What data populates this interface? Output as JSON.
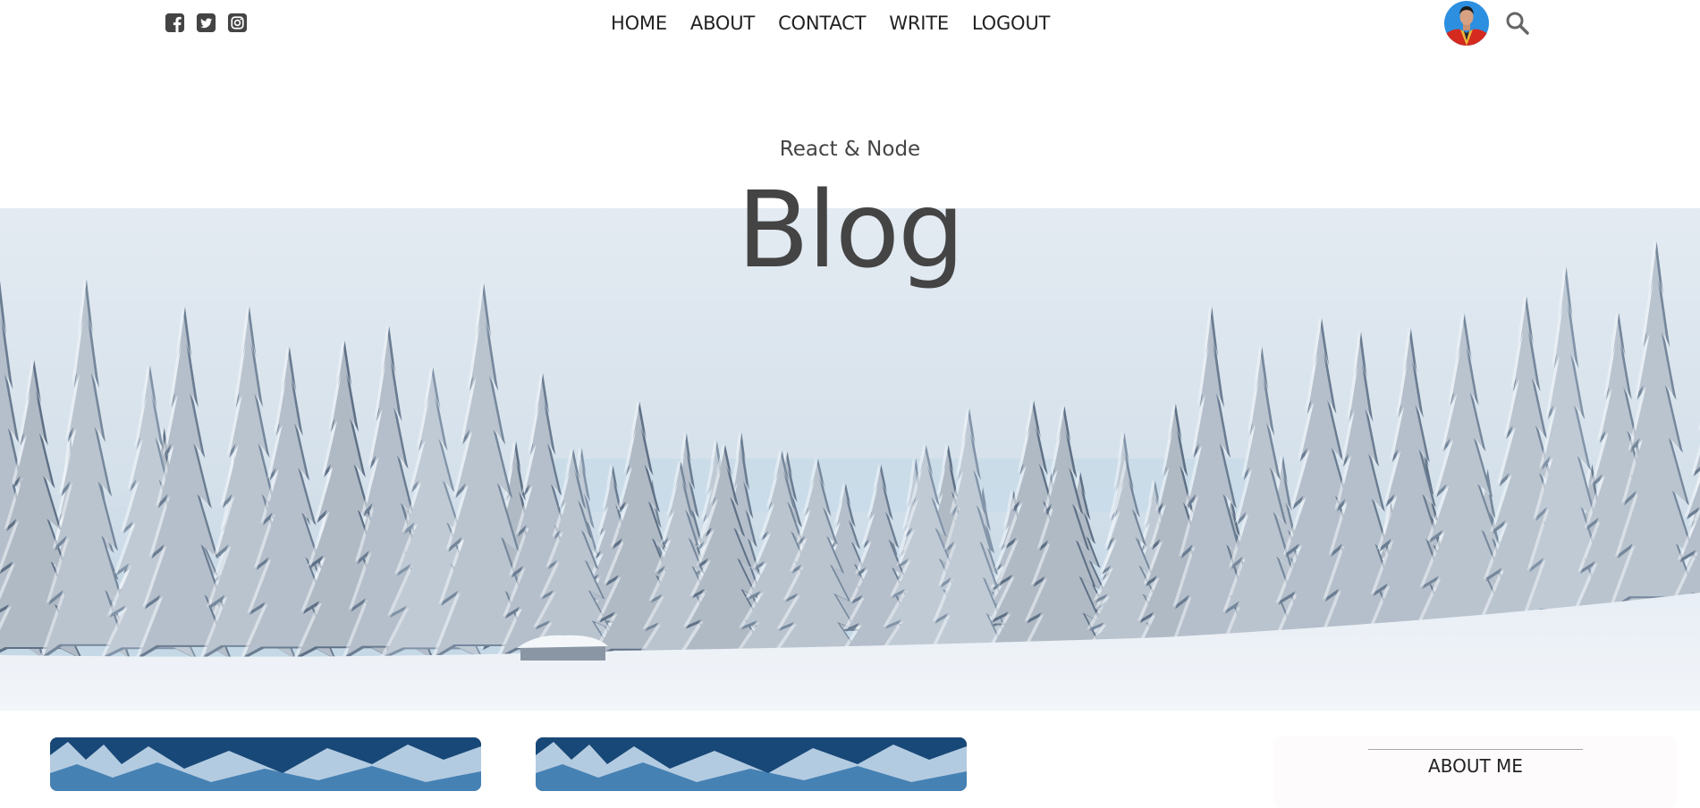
{
  "social": {
    "icons": [
      "facebook-square-icon",
      "twitter-square-icon",
      "instagram-square-icon"
    ]
  },
  "nav": {
    "items": [
      {
        "label": "HOME"
      },
      {
        "label": "ABOUT"
      },
      {
        "label": "CONTACT"
      },
      {
        "label": "WRITE"
      },
      {
        "label": "LOGOUT"
      }
    ]
  },
  "user": {
    "avatar_icon": "user-avatar"
  },
  "header": {
    "subtitle": "React & Node",
    "title": "Blog"
  },
  "sidebar": {
    "title": "ABOUT ME"
  },
  "colors": {
    "text": "#444444",
    "nav_text": "#222222",
    "sky": "#dfe8f0",
    "snow": "#eef3f8",
    "tree": "#5d6f84",
    "sidebar_bg": "#fdfbfb"
  }
}
